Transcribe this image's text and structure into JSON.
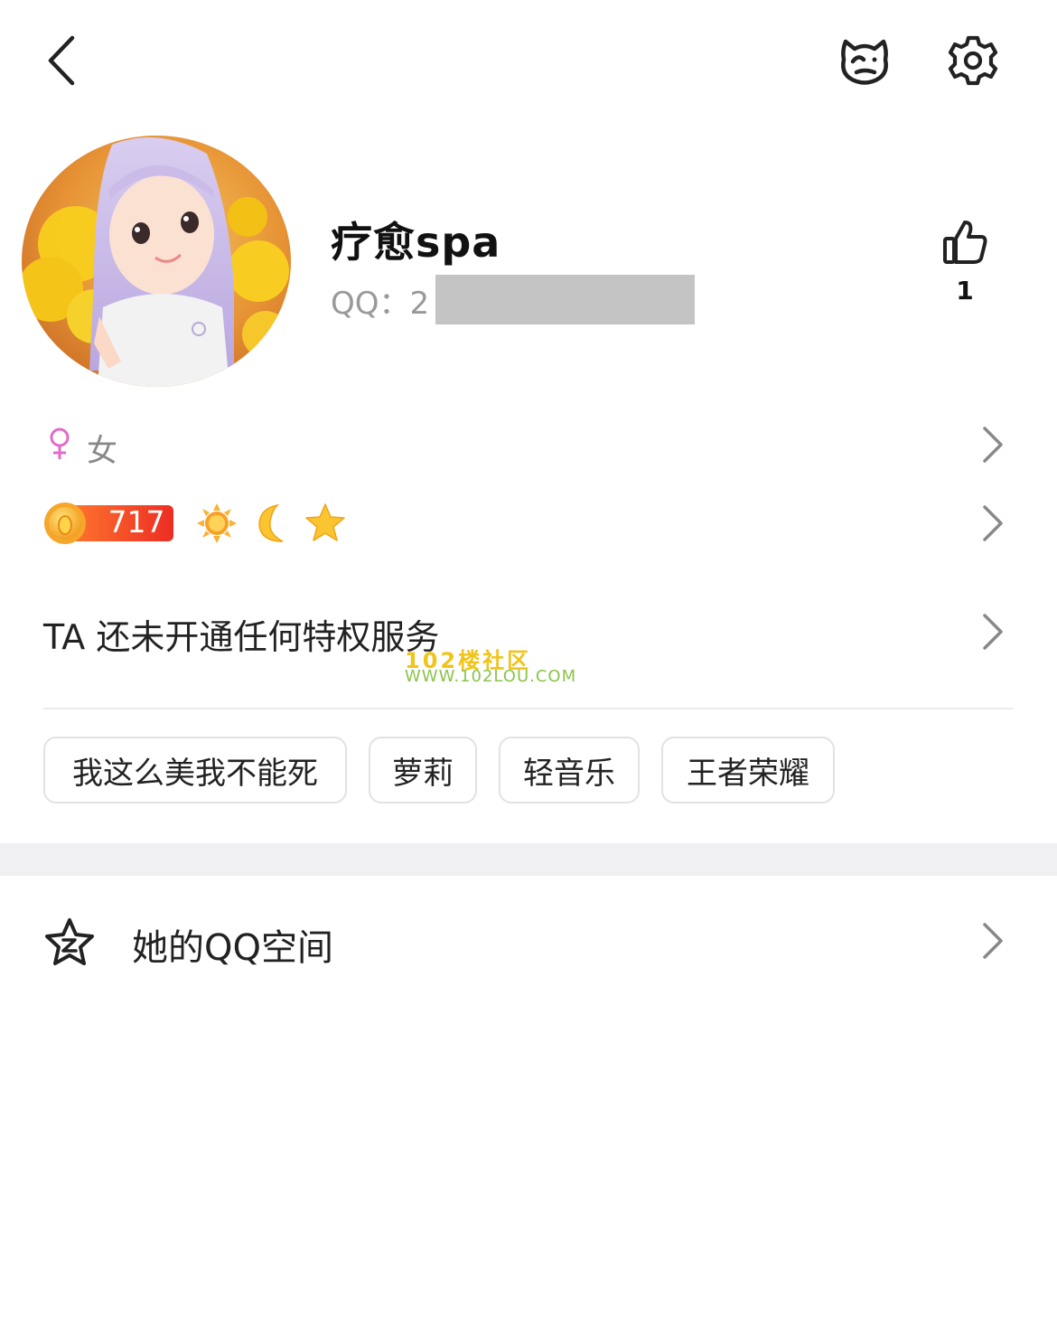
{
  "profile": {
    "nickname": "疗愈spa",
    "qq_label": "QQ：2",
    "like_count": "1",
    "gender": "女"
  },
  "level": {
    "value": "717"
  },
  "privilege": {
    "text": "TA 还未开通任何特权服务"
  },
  "watermark": {
    "line1": "102楼社区",
    "line2": "WWW.102LOU.COM"
  },
  "tags": [
    "我这么美我不能死",
    "萝莉",
    "轻音乐",
    "王者荣耀"
  ],
  "qzone": {
    "label": "她的QQ空间"
  },
  "colors": {
    "female": "#e06cc9",
    "level_red": "#f0412a",
    "level_gold": "#f5a623",
    "divider": "#ececec",
    "band": "#f0f0f2"
  },
  "icons": {
    "back": "chevron-left-icon",
    "bear": "bear-face-icon",
    "settings": "gear-icon",
    "like": "thumbs-up-icon",
    "gender": "female-symbol-icon",
    "sun": "sun-icon",
    "moon": "moon-icon",
    "star": "star-icon",
    "chevron": "chevron-right-icon",
    "qzone": "qzone-star-icon"
  }
}
